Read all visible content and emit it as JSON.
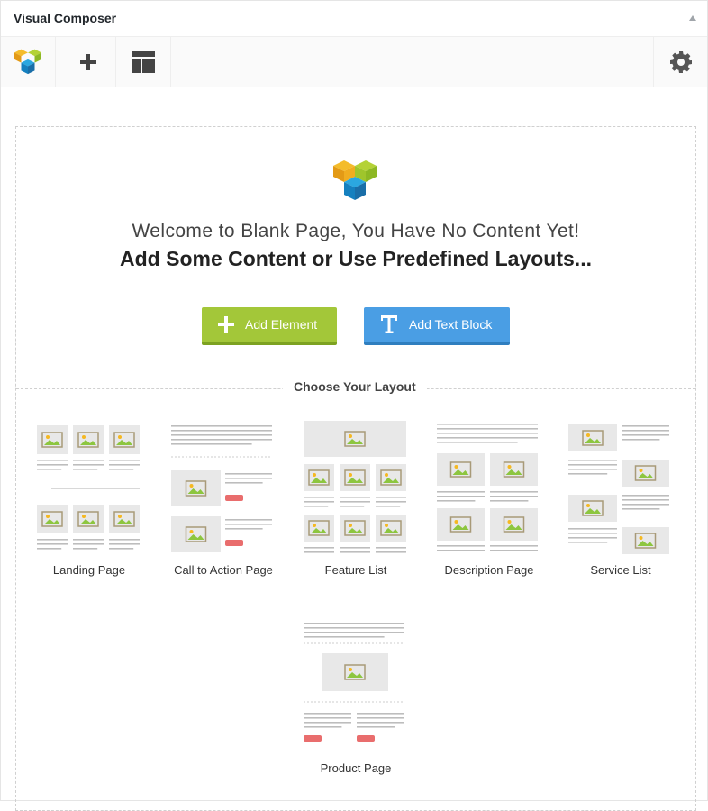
{
  "panel": {
    "title": "Visual Composer"
  },
  "icons": {
    "logo": "vc-logo-icon",
    "add": "plus-icon",
    "templates": "layout-icon",
    "settings": "gear-icon",
    "text": "text-t-icon"
  },
  "colors": {
    "add_button": "#a3c739",
    "text_button": "#4a9ee4",
    "placeholder": "#e8e8e8",
    "accent_red": "#e96d6d"
  },
  "welcome": {
    "line1": "Welcome to Blank Page, You Have No Content Yet!",
    "line2": "Add Some Content or Use Predefined Layouts..."
  },
  "buttons": {
    "add_element": "Add Element",
    "add_text_block": "Add Text Block"
  },
  "layouts_section": {
    "title": "Choose Your Layout",
    "items": [
      {
        "label": "Landing Page"
      },
      {
        "label": "Call to Action Page"
      },
      {
        "label": "Feature List"
      },
      {
        "label": "Description Page"
      },
      {
        "label": "Service List"
      },
      {
        "label": "Product Page"
      }
    ]
  }
}
